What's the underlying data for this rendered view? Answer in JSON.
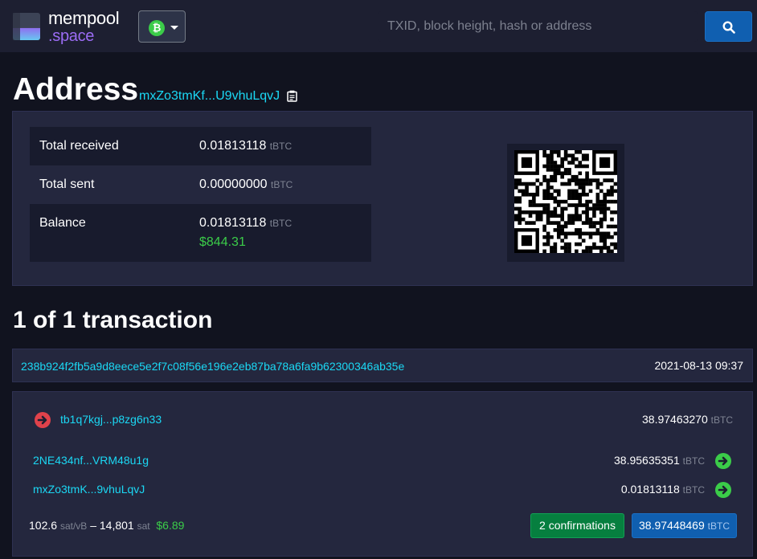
{
  "header": {
    "brand_name": "mempool",
    "brand_tld": ".space",
    "network_icon": "bitcoin-icon",
    "search_placeholder": "TXID, block height, hash or address",
    "search_icon": "search-icon"
  },
  "address": {
    "title": "Address",
    "short": "mxZo3tmKf...U9vhuLqvJ",
    "stats": [
      {
        "label": "Total received",
        "value": "0.01813118",
        "unit": "tBTC"
      },
      {
        "label": "Total sent",
        "value": "0.00000000",
        "unit": "tBTC"
      },
      {
        "label": "Balance",
        "value": "0.01813118",
        "unit": "tBTC",
        "fiat": "$844.31"
      }
    ]
  },
  "transactions": {
    "count_label": "1 of 1 transaction",
    "items": [
      {
        "txid": "238b924f2fb5a9d8eece5e2f7c08f56e196e2eb87ba78a6fa9b62300346ab35e",
        "time": "2021-08-13 09:37",
        "inputs": [
          {
            "address": "tb1q7kgj...p8zg6n33",
            "amount": "38.97463270",
            "unit": "tBTC"
          }
        ],
        "outputs": [
          {
            "address": "2NE434nf...VRM48u1g",
            "amount": "38.95635351",
            "unit": "tBTC"
          },
          {
            "address": "mxZo3tmK...9vhuLqvJ",
            "amount": "0.01813118",
            "unit": "tBTC"
          }
        ],
        "fee_rate": "102.6",
        "fee_rate_unit": "sat/vB",
        "fee_sep": "–",
        "fee": "14,801",
        "fee_unit": "sat",
        "fee_fiat": "$6.89",
        "confirmations": "2 confirmations",
        "total": "38.97448469",
        "total_unit": "tBTC"
      }
    ]
  },
  "colors": {
    "accent_link": "#1bd8f4",
    "brand_purple": "#9b6cf4",
    "green": "#3bcc49",
    "red": "#e0424b",
    "primary": "#105fb0"
  }
}
